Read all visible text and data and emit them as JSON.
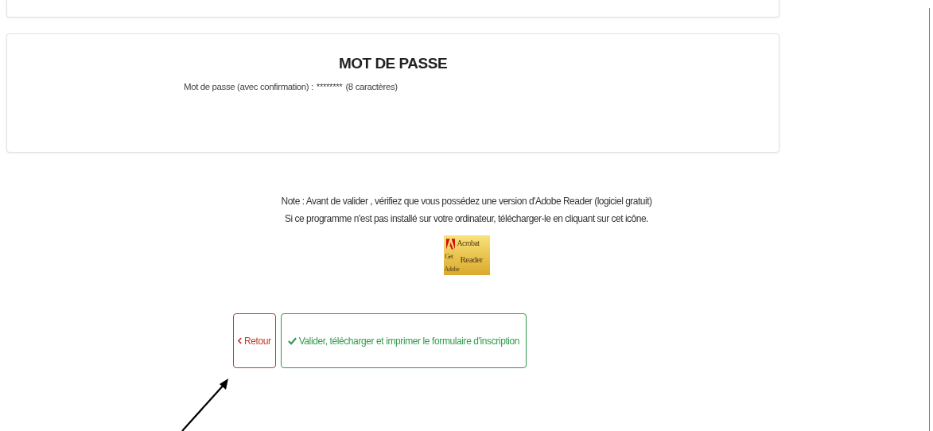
{
  "password_section": {
    "title": "MOT DE PASSE",
    "label": "Mot de passe (avec confirmation) :",
    "value": "********",
    "hint": "(8 caractères)"
  },
  "note": {
    "lines": [
      "Note : Avant de valider , vérifiez que vous possédez une version d'Adobe Reader (logiciel gratuit)",
      "Si ce programme n'est pas installé sur votre ordinateur, télécharger-le en cliquant sur cet icône."
    ]
  },
  "reader_badge": {
    "get": "Get",
    "product": "Acrobat",
    "name": "Reader",
    "brand": "Adobe"
  },
  "buttons": [
    {
      "kind": "back",
      "label": "Retour"
    },
    {
      "kind": "confirm",
      "label": "Valider, télécharger et imprimer le formulaire d'inscription"
    }
  ]
}
